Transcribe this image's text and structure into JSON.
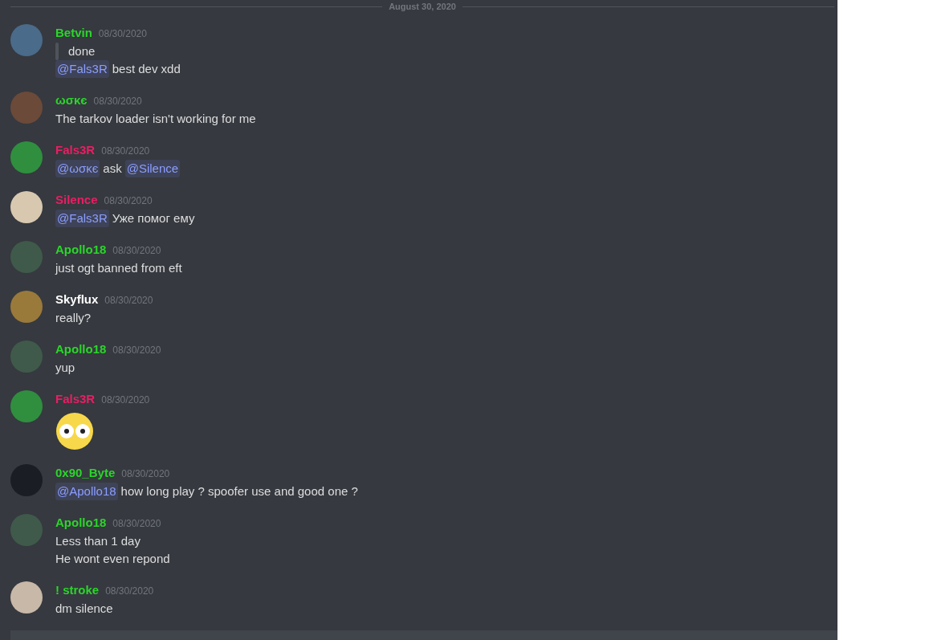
{
  "divider": {
    "label": "August 30, 2020"
  },
  "messages": [
    {
      "author": "Betvin",
      "color": "#2ad62a",
      "time": "08/30/2020",
      "lines": [
        {
          "kind": "quote",
          "parts": [
            {
              "kind": "text",
              "text": "done"
            }
          ]
        },
        {
          "kind": "text",
          "parts": [
            {
              "kind": "mention",
              "text": "@Fals3R"
            },
            {
              "kind": "text",
              "text": "best dev xdd"
            }
          ]
        }
      ]
    },
    {
      "author": "ωσκє",
      "color": "#2ad62a",
      "time": "08/30/2020",
      "lines": [
        {
          "kind": "text",
          "parts": [
            {
              "kind": "text",
              "text": "The tarkov loader isn't working for me"
            }
          ]
        }
      ]
    },
    {
      "author": "Fals3R",
      "color": "#e91e63",
      "time": "08/30/2020",
      "lines": [
        {
          "kind": "text",
          "parts": [
            {
              "kind": "mention",
              "text": "@ωσκє"
            },
            {
              "kind": "text",
              "text": "ask"
            },
            {
              "kind": "mention",
              "text": "@Silence"
            }
          ]
        }
      ]
    },
    {
      "author": "Silence",
      "color": "#e91e63",
      "time": "08/30/2020",
      "lines": [
        {
          "kind": "text",
          "parts": [
            {
              "kind": "mention",
              "text": "@Fals3R"
            },
            {
              "kind": "text",
              "text": "Уже помог ему"
            }
          ]
        }
      ]
    },
    {
      "author": "Apollo18",
      "color": "#2ad62a",
      "time": "08/30/2020",
      "lines": [
        {
          "kind": "text",
          "parts": [
            {
              "kind": "text",
              "text": "just ogt banned from eft"
            }
          ]
        }
      ]
    },
    {
      "author": "Skyflux",
      "color": "#ffffff",
      "time": "08/30/2020",
      "lines": [
        {
          "kind": "text",
          "parts": [
            {
              "kind": "text",
              "text": "really?"
            }
          ]
        }
      ]
    },
    {
      "author": "Apollo18",
      "color": "#2ad62a",
      "time": "08/30/2020",
      "lines": [
        {
          "kind": "text",
          "parts": [
            {
              "kind": "text",
              "text": "yup"
            }
          ]
        }
      ]
    },
    {
      "author": "Fals3R",
      "color": "#e91e63",
      "time": "08/30/2020",
      "lines": [
        {
          "kind": "emoji"
        }
      ]
    },
    {
      "author": "0x90_Byte",
      "color": "#2ad62a",
      "time": "08/30/2020",
      "lines": [
        {
          "kind": "text",
          "parts": [
            {
              "kind": "mention",
              "text": "@Apollo18"
            },
            {
              "kind": "text",
              "text": "how long play ? spoofer use and good one ?"
            }
          ]
        }
      ]
    },
    {
      "author": "Apollo18",
      "color": "#2ad62a",
      "time": "08/30/2020",
      "lines": [
        {
          "kind": "text",
          "parts": [
            {
              "kind": "text",
              "text": "Less than 1 day"
            }
          ]
        },
        {
          "kind": "text",
          "parts": [
            {
              "kind": "text",
              "text": "He wont even repond"
            }
          ]
        }
      ]
    },
    {
      "author": "! stroke",
      "color": "#2ad62a",
      "time": "08/30/2020",
      "lines": [
        {
          "kind": "text",
          "parts": [
            {
              "kind": "text",
              "text": "dm silence"
            }
          ]
        }
      ]
    }
  ]
}
